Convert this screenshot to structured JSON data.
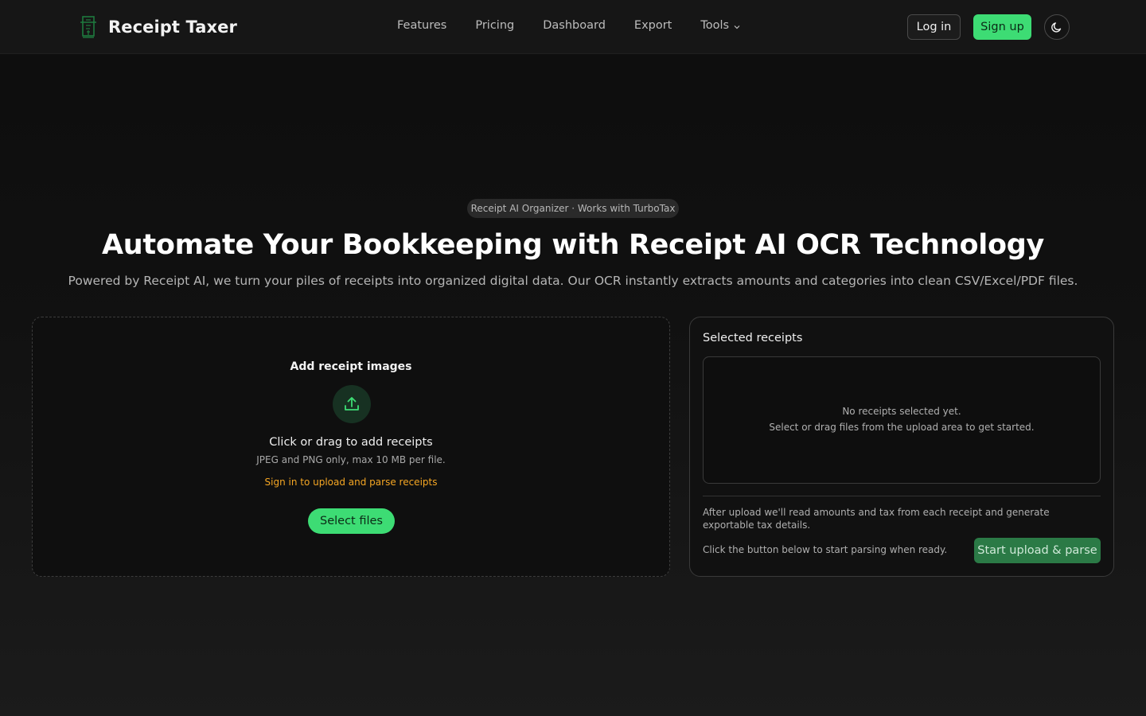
{
  "header": {
    "brand_name": "Receipt Taxer",
    "nav": [
      "Features",
      "Pricing",
      "Dashboard",
      "Export"
    ],
    "tools_label": "Tools",
    "login_label": "Log in",
    "signup_label": "Sign up",
    "theme_icon": "moon-icon"
  },
  "hero": {
    "badge": "Receipt AI Organizer · Works with TurboTax",
    "title": "Automate Your Bookkeeping with Receipt AI OCR Technology",
    "subtitle": "Powered by Receipt AI, we turn your piles of receipts into organized digital data. Our OCR instantly extracts amounts and categories into clean CSV/Excel/PDF files."
  },
  "upload": {
    "title": "Add receipt images",
    "icon": "upload-icon",
    "cta": "Click or drag to add receipts",
    "hint": "JPEG and PNG only, max 10 MB per file.",
    "warning": "Sign in to upload and parse receipts",
    "button": "Select files"
  },
  "selected": {
    "title": "Selected receipts",
    "empty_line1": "No receipts selected yet.",
    "empty_line2": "Select or drag files from the upload area to get started.",
    "info": "After upload we'll read amounts and tax from each receipt and generate exportable tax details.",
    "prompt": "Click the button below to start parsing when ready.",
    "button": "Start upload & parse"
  },
  "colors": {
    "accent": "#3ddc74",
    "accent_dark": "#2b7a46",
    "warning": "#f5a623",
    "background": "#0d0d0d"
  }
}
